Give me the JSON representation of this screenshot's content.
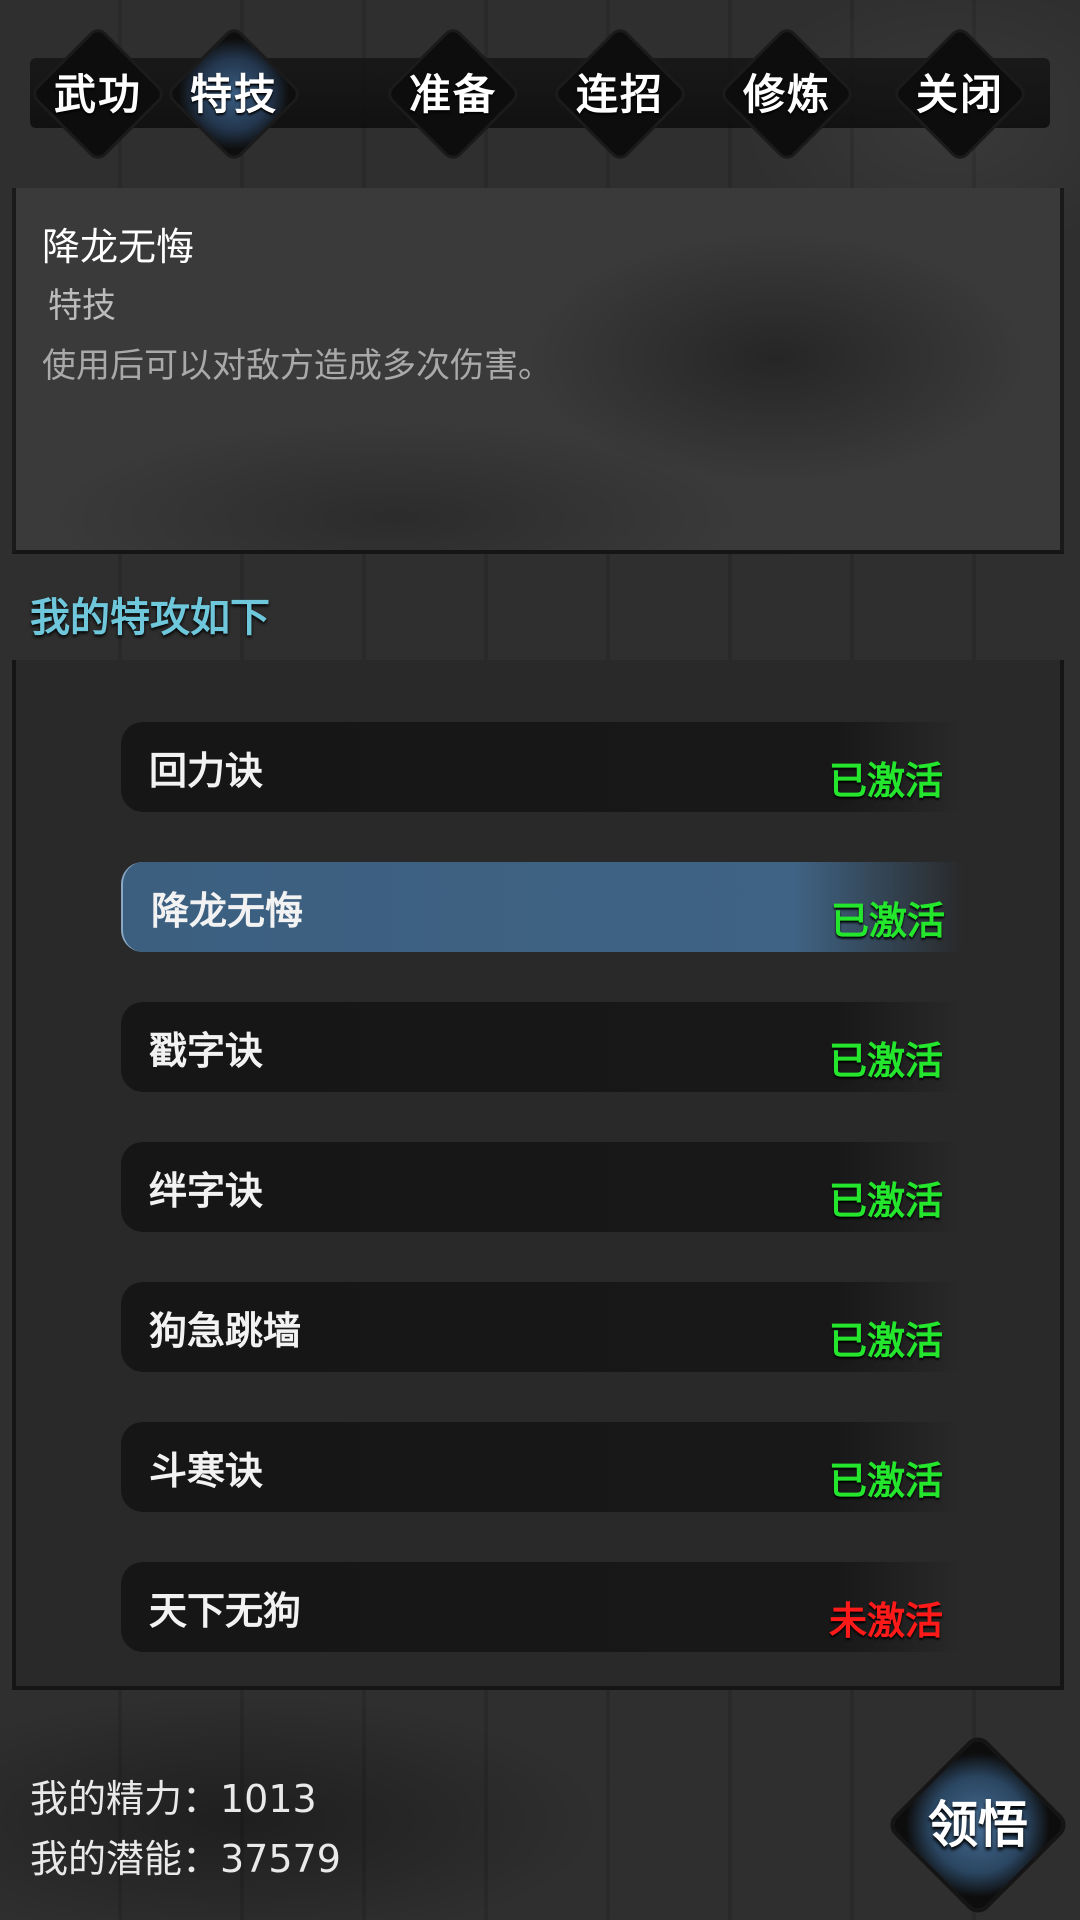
{
  "tabs": [
    {
      "label": "武功"
    },
    {
      "label": "特技",
      "active": true
    },
    {
      "label": "准备"
    },
    {
      "label": "连招"
    },
    {
      "label": "修炼"
    },
    {
      "label": "关闭"
    }
  ],
  "detail": {
    "title": "降龙无悔",
    "type": "特技",
    "description": "使用后可以对敌方造成多次伤害。"
  },
  "section_header": "我的特攻如下",
  "skills": [
    {
      "name": "回力诀",
      "status": "已激活",
      "active": true
    },
    {
      "name": "降龙无悔",
      "status": "已激活",
      "active": true,
      "selected": true
    },
    {
      "name": "戳字诀",
      "status": "已激活",
      "active": true
    },
    {
      "name": "绊字诀",
      "status": "已激活",
      "active": true
    },
    {
      "name": "狗急跳墙",
      "status": "已激活",
      "active": true
    },
    {
      "name": "斗寒诀",
      "status": "已激活",
      "active": true
    },
    {
      "name": "天下无狗",
      "status": "未激活",
      "active": false
    }
  ],
  "footer": {
    "energy_text": "我的精力：1013",
    "potential_text": "我的潜能：37579",
    "comprehend_label": "领悟"
  },
  "colors": {
    "activated": "#24e62c",
    "inactive": "#ff1a1a",
    "accent_blue": "#3c5f80",
    "header_cyan": "#6fc7dc"
  }
}
